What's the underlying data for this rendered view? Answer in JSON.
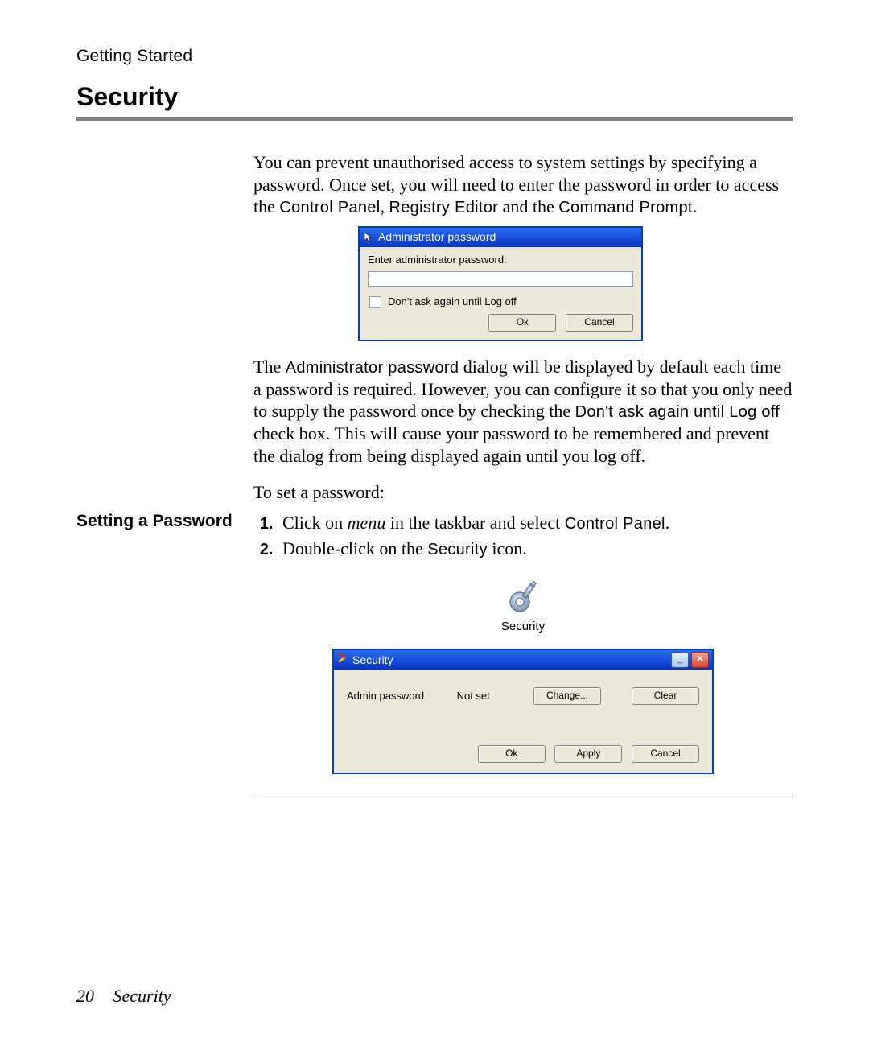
{
  "header": {
    "running": "Getting Started",
    "title": "Security"
  },
  "intro": {
    "text_a": "You can prevent unauthorised access to system settings by specifying a password. Once set, you will need to enter the password in order to access the ",
    "cp": "Control Panel",
    "text_b": ", ",
    "re": "Registry Editor",
    "text_c": " and the ",
    "cmd": "Command Prompt",
    "text_d": "."
  },
  "dialog1": {
    "title": "Administrator password",
    "prompt": "Enter administrator password:",
    "checkbox": "Don't ask again until Log off",
    "ok": "Ok",
    "cancel": "Cancel"
  },
  "para2": {
    "a": "The ",
    "admin": "Administrator password",
    "b": " dialog will be displayed by default each time a password is required. However, you can configure it so that you only need to supply the password once by checking the ",
    "chk": "Don't ask again until Log off",
    "c": " check box. This will cause your password to be remembered and prevent the dialog from being displayed again until you log off."
  },
  "setting": {
    "heading": "Setting a Password",
    "lead": "To set a password:",
    "step1_a": "Click on ",
    "step1_menu": "menu",
    "step1_b": " in the taskbar and select ",
    "step1_cp": "Control Panel",
    "step1_c": ".",
    "step2_a": "Double-click on the ",
    "step2_sec": "Security",
    "step2_b": " icon."
  },
  "icon_label": "Security",
  "dialog2": {
    "title": "Security",
    "row_label": "Admin password",
    "row_value": "Not set",
    "change": "Change...",
    "clear": "Clear",
    "ok": "Ok",
    "apply": "Apply",
    "cancel": "Cancel"
  },
  "footer": {
    "page": "20",
    "title": "Security"
  }
}
